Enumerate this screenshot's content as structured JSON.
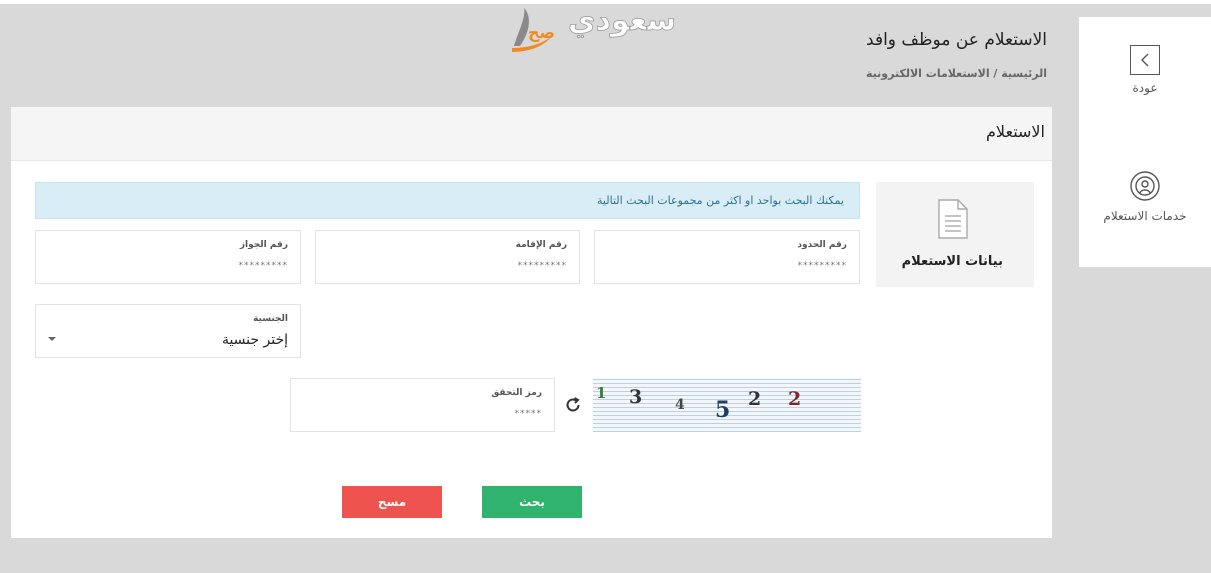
{
  "logo": {
    "text": "سعودي",
    "mark": "صح"
  },
  "header": {
    "title": "الاستعلام عن موظف وافد",
    "breadcrumb": "الرئيسية / الاستعلامات الالكترونية"
  },
  "side_panel": {
    "items": [
      {
        "label": "عودة",
        "icon": "chevron-left-icon"
      },
      {
        "label": "خدمات الاستعلام",
        "icon": "broadcast-icon"
      }
    ]
  },
  "card": {
    "title": "الاستعلام",
    "data_tile": {
      "label": "بيانات الاستعلام",
      "icon": "document-icon"
    },
    "info_text": "يمكنك البحث بواحد او اكثر من مجموعات البحث التالية",
    "fields": {
      "border_number": {
        "label": "رقم الحدود",
        "placeholder": "*********"
      },
      "iqama_number": {
        "label": "رقم الإقامة",
        "placeholder": "*********"
      },
      "passport_number": {
        "label": "رقم الجواز",
        "placeholder": "*********"
      },
      "nationality": {
        "label": "الجنسية",
        "value": "إختر جنسية"
      },
      "captcha": {
        "label": "رمز التحقق",
        "placeholder": "*****"
      }
    },
    "captcha_digits": [
      "1",
      "3",
      "4",
      "5",
      "2",
      "2"
    ],
    "buttons": {
      "search": "بحث",
      "clear": "مسح"
    }
  },
  "colors": {
    "search_button": "#2fb36d",
    "clear_button": "#ef5350",
    "info_background": "#d9edf7",
    "logo_orange": "#f08a24"
  }
}
